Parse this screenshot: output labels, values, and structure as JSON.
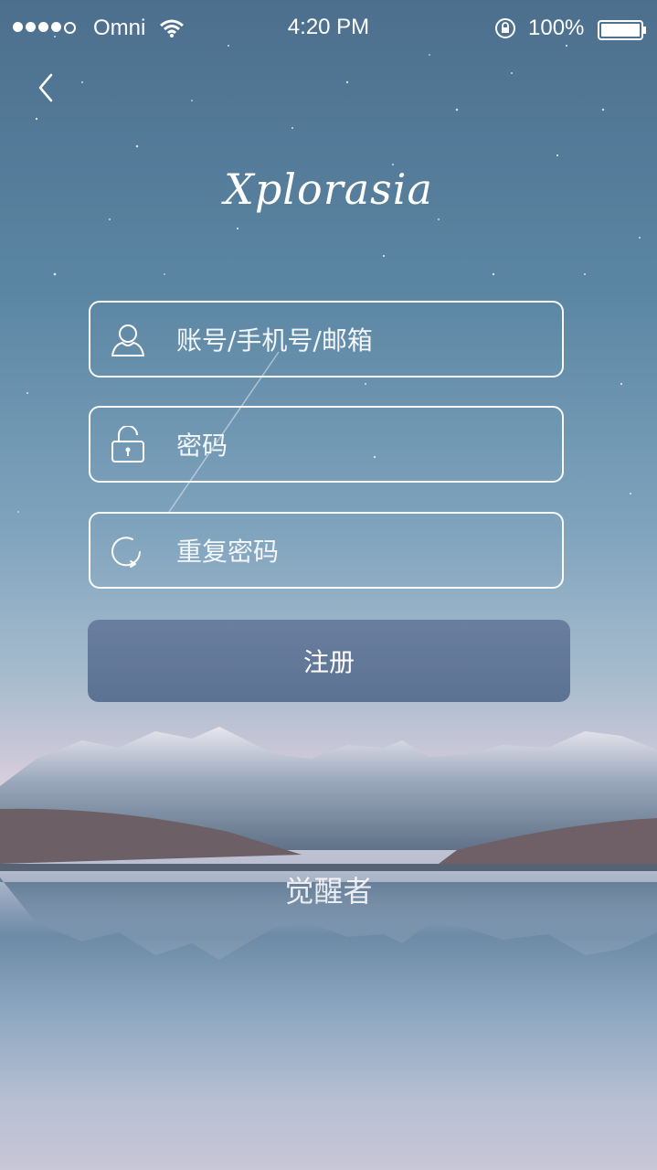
{
  "status_bar": {
    "carrier": "Omni",
    "time": "4:20 PM",
    "battery": "100%"
  },
  "header": {
    "logo": "Xplorasia"
  },
  "form": {
    "account_placeholder": "账号/手机号/邮箱",
    "password_placeholder": "密码",
    "repeat_password_placeholder": "重复密码",
    "register_label": "注册"
  },
  "footer": {
    "tagline": "觉醒者"
  },
  "colors": {
    "button": "#5f7495",
    "field_border": "#ffffff"
  }
}
